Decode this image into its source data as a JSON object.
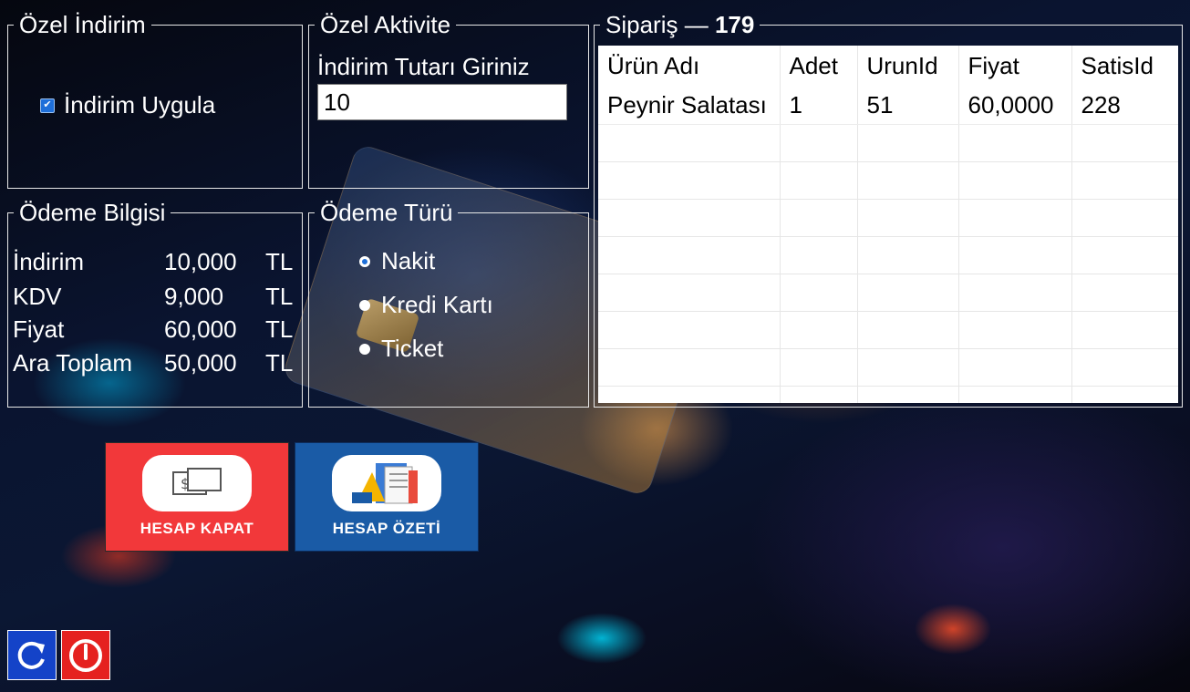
{
  "ozel_indirim": {
    "legend": "Özel İndirim",
    "checkbox_label": "İndirim Uygula",
    "checked": true
  },
  "ozel_aktivite": {
    "legend": "Özel Aktivite",
    "input_label": "İndirim Tutarı Giriniz",
    "input_value": "10"
  },
  "odeme_bilgisi": {
    "legend": "Ödeme Bilgisi",
    "rows": [
      {
        "key": "İndirim",
        "value": "10,000",
        "unit": "TL"
      },
      {
        "key": "KDV",
        "value": "9,000",
        "unit": "TL"
      },
      {
        "key": "Fiyat",
        "value": "60,000",
        "unit": "TL"
      },
      {
        "key": "Ara Toplam",
        "value": "50,000",
        "unit": "TL"
      }
    ]
  },
  "odeme_turu": {
    "legend": "Ödeme Türü",
    "options": [
      "Nakit",
      "Kredi Kartı",
      "Ticket"
    ],
    "selected": "Nakit"
  },
  "siparis": {
    "legend_label": "Sipariş",
    "legend_number": "179",
    "columns": [
      "Ürün Adı",
      "Adet",
      "UrunId",
      "Fiyat",
      "SatisId"
    ],
    "rows": [
      [
        "Peynir Salatası",
        "1",
        "51",
        "60,0000",
        "228"
      ]
    ]
  },
  "buttons": {
    "hesap_kapat": "HESAP KAPAT",
    "hesap_ozeti": "HESAP ÖZETİ"
  },
  "colors": {
    "hesap_kapat_bg": "#f2383a",
    "hesap_ozeti_bg": "#1a5ba6",
    "refresh_bg": "#1443c8",
    "power_bg": "#e5211f"
  },
  "icons": {
    "hesap_kapat": "cash-payment-icon",
    "hesap_ozeti": "report-documents-icon",
    "refresh": "refresh-icon",
    "power": "power-icon"
  }
}
